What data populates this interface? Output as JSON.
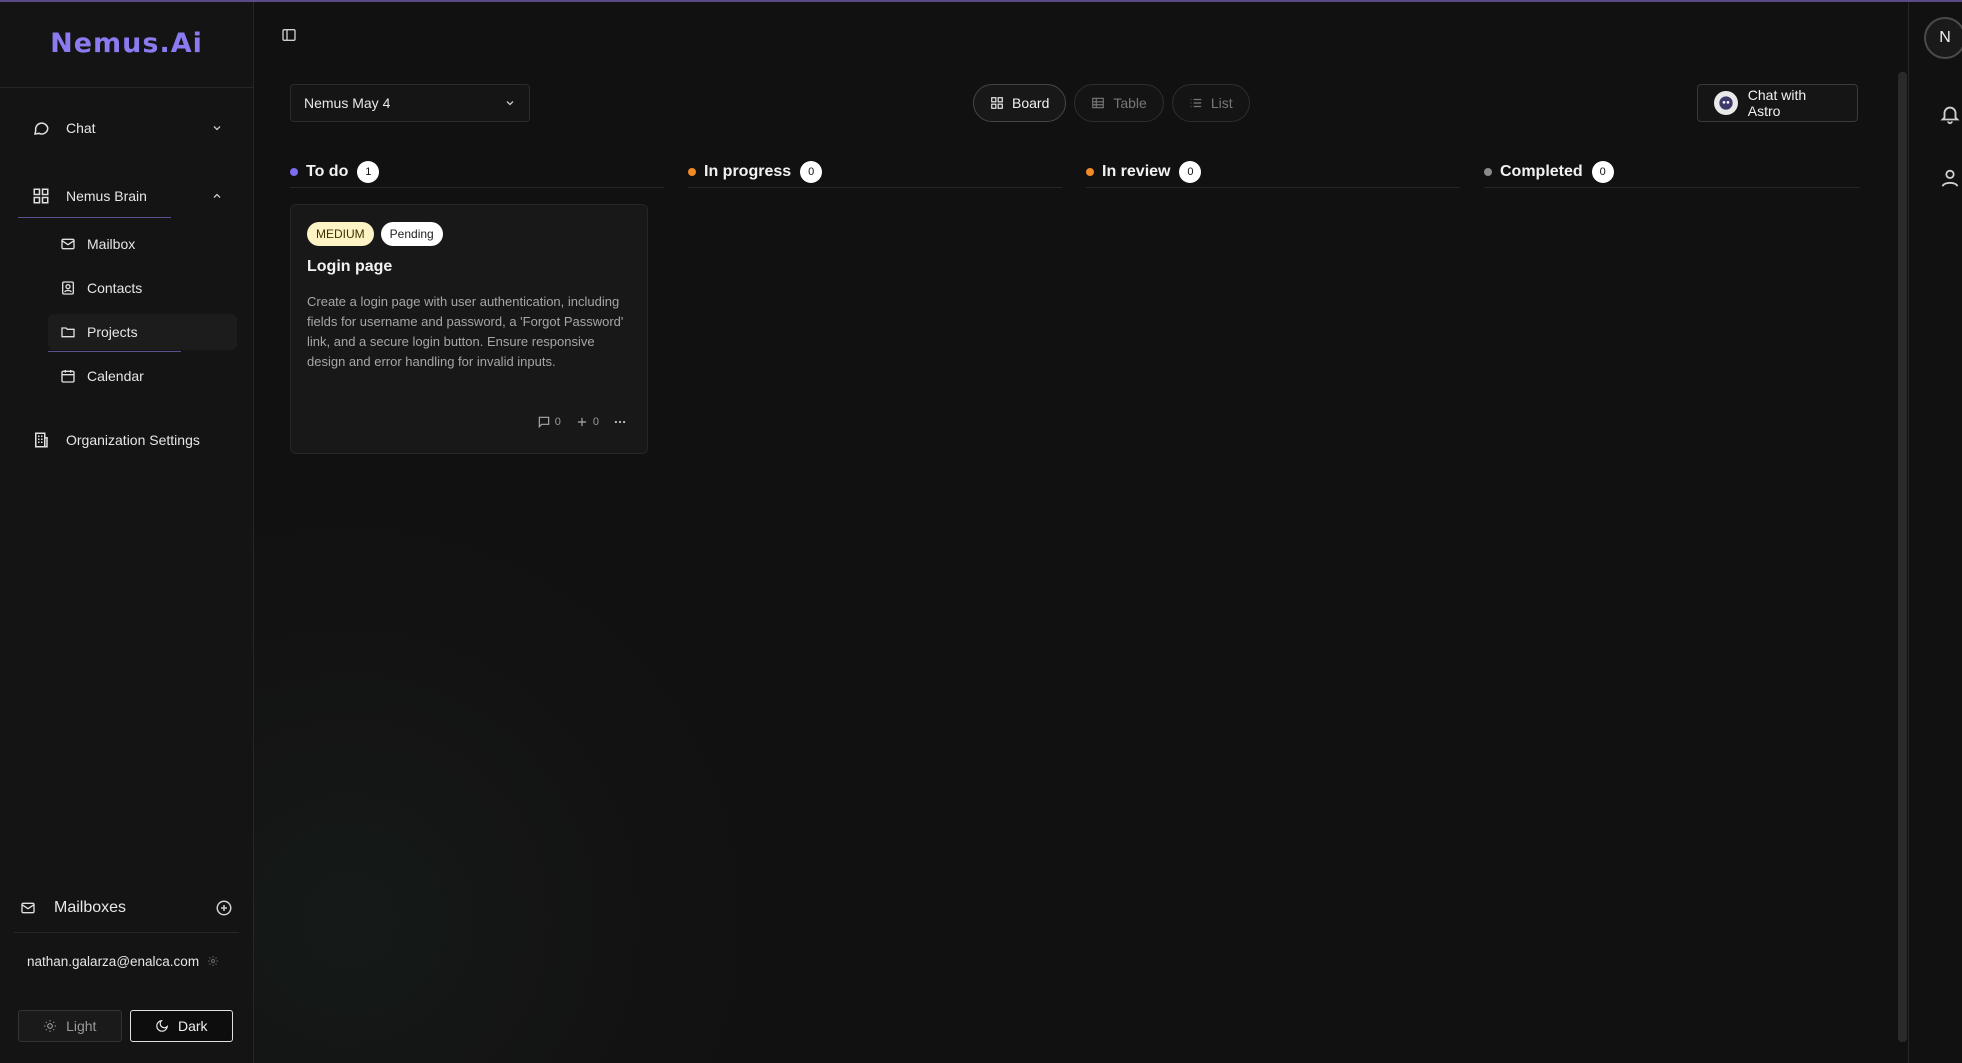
{
  "app": {
    "logo": "Nemus.Ai",
    "accent_color": "#8a7cf0"
  },
  "sidebar": {
    "chat": {
      "label": "Chat",
      "icon": "chat-icon"
    },
    "brain": {
      "label": "Nemus Brain",
      "icon": "grid-icon"
    },
    "sub_items": [
      {
        "label": "Mailbox",
        "icon": "mail-icon"
      },
      {
        "label": "Contacts",
        "icon": "contact-icon"
      },
      {
        "label": "Projects",
        "icon": "folder-icon",
        "active": true
      },
      {
        "label": "Calendar",
        "icon": "calendar-icon"
      }
    ],
    "org_settings": {
      "label": "Organization Settings",
      "icon": "building-icon"
    },
    "mailboxes": {
      "title": "Mailboxes",
      "account": "nathan.galarza@enalca.com"
    },
    "theme": {
      "light_label": "Light",
      "dark_label": "Dark",
      "selected": "Dark"
    }
  },
  "toolbar": {
    "project_selected": "Nemus May 4",
    "views": [
      {
        "label": "Board",
        "active": true
      },
      {
        "label": "Table",
        "active": false
      },
      {
        "label": "List",
        "active": false
      }
    ],
    "astro_label": "Chat with Astro"
  },
  "board": {
    "columns": [
      {
        "title": "To do",
        "count": "1",
        "dot_color": "#7b6cf0"
      },
      {
        "title": "In progress",
        "count": "0",
        "dot_color": "#f08a24"
      },
      {
        "title": "In review",
        "count": "0",
        "dot_color": "#f08a24"
      },
      {
        "title": "Completed",
        "count": "0",
        "dot_color": "#8a8a8a"
      }
    ],
    "card": {
      "priority": "MEDIUM",
      "status": "Pending",
      "title": "Login page",
      "description": "Create a login page with user authentication, including fields for username and password, a 'Forgot Password' link, and a secure login button. Ensure responsive design and error handling for invalid inputs.",
      "comments": "0",
      "subtasks": "0"
    }
  },
  "rail": {
    "avatar_letter": "N"
  }
}
